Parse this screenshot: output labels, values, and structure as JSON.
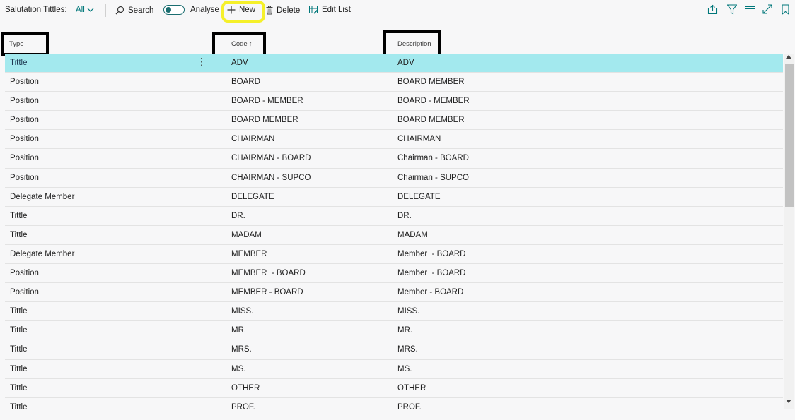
{
  "toolbar": {
    "title": "Salutation Tittles:",
    "filter_label": "All",
    "search_label": "Search",
    "analyse_label": "Analyse",
    "new_label": "New",
    "delete_label": "Delete",
    "edit_list_label": "Edit List",
    "right_icons": [
      "share-icon",
      "filter-icon",
      "list-view-icon",
      "expand-icon",
      "bookmark-icon"
    ]
  },
  "columns": {
    "type": "Type",
    "code": "Code",
    "code_sort": "↑",
    "description": "Description"
  },
  "rows": [
    {
      "type": "Tittle",
      "code": "ADV",
      "description": "ADV",
      "selected": true
    },
    {
      "type": "Position",
      "code": "BOARD",
      "description": "BOARD MEMBER"
    },
    {
      "type": "Position",
      "code": "BOARD - MEMBER",
      "description": "BOARD - MEMBER"
    },
    {
      "type": "Position",
      "code": "BOARD MEMBER",
      "description": "BOARD MEMBER"
    },
    {
      "type": "Position",
      "code": "CHAIRMAN",
      "description": "CHAIRMAN"
    },
    {
      "type": "Position",
      "code": "CHAIRMAN - BOARD",
      "description": "Chairman - BOARD"
    },
    {
      "type": "Position",
      "code": "CHAIRMAN - SUPCO",
      "description": "Chairman - SUPCO"
    },
    {
      "type": "Delegate Member",
      "code": "DELEGATE",
      "description": "DELEGATE"
    },
    {
      "type": "Tittle",
      "code": "DR.",
      "description": "DR."
    },
    {
      "type": "Tittle",
      "code": "MADAM",
      "description": "MADAM"
    },
    {
      "type": "Delegate Member",
      "code": "MEMBER",
      "description": "Member  - BOARD"
    },
    {
      "type": "Position",
      "code": "MEMBER  - BOARD",
      "description": "Member  - BOARD"
    },
    {
      "type": "Position",
      "code": "MEMBER - BOARD",
      "description": "Member - BOARD"
    },
    {
      "type": "Tittle",
      "code": "MISS.",
      "description": "MISS."
    },
    {
      "type": "Tittle",
      "code": "MR.",
      "description": "MR."
    },
    {
      "type": "Tittle",
      "code": "MRS.",
      "description": "MRS."
    },
    {
      "type": "Tittle",
      "code": "MS.",
      "description": "MS."
    },
    {
      "type": "Tittle",
      "code": "OTHER",
      "description": "OTHER"
    },
    {
      "type": "Tittle",
      "code": "PROF.",
      "description": "PROF."
    }
  ],
  "colors": {
    "accent": "#00777a",
    "selected_row": "#a3e9ee",
    "highlight": "#f5f02a"
  }
}
